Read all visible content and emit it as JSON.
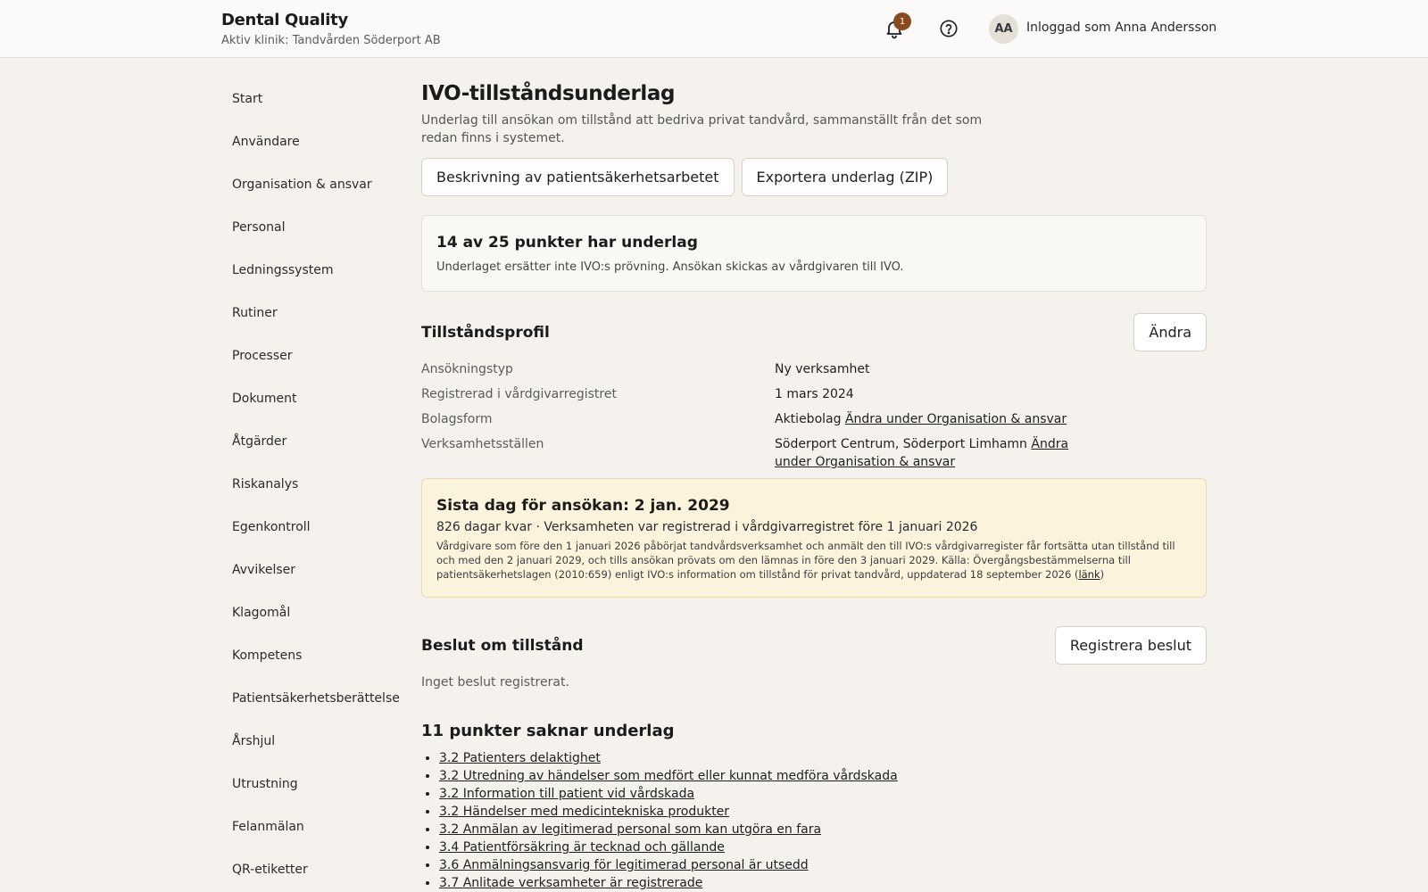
{
  "header": {
    "app_title": "Dental Quality",
    "clinic": "Aktiv klinik: Tandvården Söderport AB",
    "notification_count": "1",
    "avatar_initials": "AA",
    "user_label": "Inloggad som Anna Andersson"
  },
  "sidebar": {
    "items": [
      {
        "label": "Start"
      },
      {
        "label": "Användare"
      },
      {
        "label": "Organisation & ansvar"
      },
      {
        "label": "Personal"
      },
      {
        "label": "Ledningssystem"
      },
      {
        "label": "Rutiner"
      },
      {
        "label": "Processer"
      },
      {
        "label": "Dokument"
      },
      {
        "label": "Åtgärder"
      },
      {
        "label": "Riskanalys"
      },
      {
        "label": "Egenkontroll"
      },
      {
        "label": "Avvikelser"
      },
      {
        "label": "Klagomål"
      },
      {
        "label": "Kompetens"
      },
      {
        "label": "Patientsäkerhetsberättelse"
      },
      {
        "label": "Årshjul"
      },
      {
        "label": "Utrustning"
      },
      {
        "label": "Felanmälan"
      },
      {
        "label": "QR-etiketter"
      }
    ]
  },
  "main": {
    "title": "IVO-tillståndsunderlag",
    "description": "Underlag till ansökan om tillstånd att bedriva privat tandvård, sammanställt från det som redan finns i systemet.",
    "buttons": {
      "describe": "Beskrivning av patientsäkerhetsarbetet",
      "export": "Exportera underlag (ZIP)"
    },
    "summary": {
      "title": "14 av 25 punkter har underlag",
      "text": "Underlaget ersätter inte IVO:s prövning. Ansökan skickas av vårdgivaren till IVO."
    },
    "profile": {
      "title": "Tillståndsprofil",
      "edit_label": "Ändra",
      "rows": [
        {
          "label": "Ansökningstyp",
          "value": "Ny verksamhet",
          "link": ""
        },
        {
          "label": "Registrerad i vårdgivarregistret",
          "value": "1 mars 2024",
          "link": ""
        },
        {
          "label": "Bolagsform",
          "value": "Aktiebolag",
          "link": "Ändra under Organisation & ansvar"
        },
        {
          "label": "Verksamhetsställen",
          "value": "Söderport Centrum, Söderport Limhamn",
          "link": "Ändra under Organisation & ansvar"
        }
      ]
    },
    "deadline": {
      "title": "Sista dag för ansökan: 2 jan. 2029",
      "subtitle": "826 dagar kvar · Verksamheten var registrerad i vårdgivarregistret före 1 januari 2026",
      "note": "Vårdgivare som före den 1 januari 2026 påbörjat tandvårdsverksamhet och anmält den till IVO:s vårdgivarregister får fortsätta utan tillstånd till och med den 2 januari 2029, och tills ansökan prövats om den lämnas in före den 3 januari 2029. Källa: Övergångsbestämmelserna till patientsäkerhetslagen (2010:659) enligt IVO:s information om tillstånd för privat tandvård, uppdaterad 18 september 2026",
      "link_label": "länk"
    },
    "decision": {
      "title": "Beslut om tillstånd",
      "register_label": "Registrera beslut",
      "empty_text": "Inget beslut registrerat."
    },
    "missing": {
      "title": "11 punkter saknar underlag",
      "items": [
        "3.2 Patienters delaktighet",
        "3.2 Utredning av händelser som medfört eller kunnat medföra vårdskada",
        "3.2 Information till patient vid vårdskada",
        "3.2 Händelser med medicintekniska produkter",
        "3.2 Anmälan av legitimerad personal som kan utgöra en fara",
        "3.4 Patientförsäkring är tecknad och gällande",
        "3.6 Anmälningsansvarig för legitimerad personal är utsedd",
        "3.7 Anlitade verksamheter är registrerade"
      ]
    }
  }
}
